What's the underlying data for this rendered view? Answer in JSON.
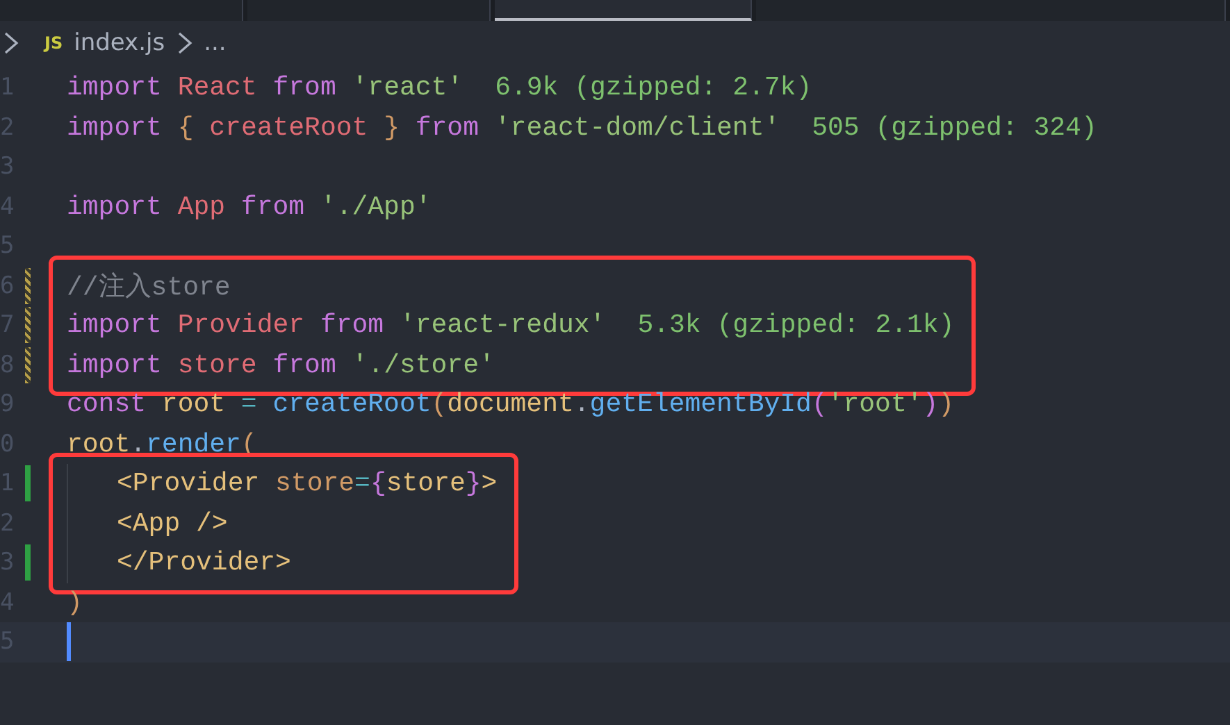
{
  "tabs": [
    {
      "selected": false
    },
    {
      "selected": false
    },
    {
      "selected": true
    },
    {
      "selected": false
    }
  ],
  "breadcrumb": {
    "file_badge": "JS",
    "file": "index.js",
    "more": "..."
  },
  "lines": [
    {
      "kind": "line",
      "number": "1",
      "tokens": [
        {
          "kind": "keyword",
          "text": "import"
        },
        {
          "kind": "variable",
          "text": " React"
        },
        {
          "kind": "keyword",
          "text": " from"
        },
        {
          "kind": "string",
          "text": " 'react'"
        }
      ],
      "hint": "6.9k (gzipped: 2.7k)"
    },
    {
      "kind": "line",
      "number": "2",
      "tokens": [
        {
          "kind": "keyword",
          "text": "import"
        },
        {
          "kind": "bracket",
          "text": " {"
        },
        {
          "kind": "variable",
          "text": " createRoot "
        },
        {
          "kind": "bracket",
          "text": "}"
        },
        {
          "kind": "keyword",
          "text": " from"
        },
        {
          "kind": "string",
          "text": " 'react-dom/client'"
        }
      ],
      "hint": "505 (gzipped: 324)"
    },
    {
      "kind": "line",
      "number": "3"
    },
    {
      "kind": "line",
      "number": "4",
      "tokens": [
        {
          "kind": "keyword",
          "text": "import"
        },
        {
          "kind": "variable",
          "text": " App"
        },
        {
          "kind": "keyword",
          "text": " from"
        },
        {
          "kind": "string",
          "text": " './App'"
        }
      ]
    },
    {
      "kind": "line",
      "number": "5"
    },
    {
      "kind": "highlight",
      "lines": [
        {
          "kind": "line",
          "number": "6",
          "modified": true,
          "tokens": [
            {
              "kind": "comment",
              "text": "//注入store"
            }
          ]
        },
        {
          "kind": "line",
          "number": "7",
          "modified": true,
          "tokens": [
            {
              "kind": "keyword",
              "text": "import"
            },
            {
              "kind": "variable",
              "text": " Provider"
            },
            {
              "kind": "keyword",
              "text": " from"
            },
            {
              "kind": "string",
              "text": " 'react-redux'"
            }
          ],
          "hint": "5.3k (gzipped: 2.1k)"
        },
        {
          "kind": "line",
          "number": "8",
          "modified": true,
          "tokens": [
            {
              "kind": "keyword",
              "text": "import"
            },
            {
              "kind": "variable",
              "text": " store"
            },
            {
              "kind": "keyword",
              "text": " from"
            },
            {
              "kind": "string",
              "text": " './store'"
            }
          ]
        }
      ]
    },
    {
      "kind": "line",
      "number": "9",
      "tokens": [
        {
          "kind": "keyword",
          "text": "const"
        },
        {
          "kind": "param",
          "text": " root"
        },
        {
          "kind": "operator",
          "text": " ="
        },
        {
          "kind": "function",
          "text": " createRoot"
        },
        {
          "kind": "bracket",
          "text": "("
        },
        {
          "kind": "param",
          "text": "document"
        },
        {
          "kind": "plain",
          "text": "."
        },
        {
          "kind": "function",
          "text": "getElementById"
        },
        {
          "kind": "bracket2",
          "text": "("
        },
        {
          "kind": "string",
          "text": "'root'"
        },
        {
          "kind": "bracket2",
          "text": ")"
        },
        {
          "kind": "bracket",
          "text": ")"
        }
      ]
    },
    {
      "kind": "line",
      "number": "0",
      "tokens": [
        {
          "kind": "param",
          "text": "root"
        },
        {
          "kind": "plain",
          "text": "."
        },
        {
          "kind": "function",
          "text": "render"
        },
        {
          "kind": "bracket",
          "text": "("
        }
      ],
      "children": [
        {
          "kind": "highlight",
          "lines": [
            {
              "kind": "line",
              "number": "1",
              "added": true,
              "tokens": [
                {
                  "kind": "tag",
                  "text": "<Provider"
                },
                {
                  "kind": "attr",
                  "text": " store"
                },
                {
                  "kind": "operator",
                  "text": "="
                },
                {
                  "kind": "bracket2",
                  "text": "{"
                },
                {
                  "kind": "tag",
                  "text": "store"
                },
                {
                  "kind": "bracket2",
                  "text": "}"
                },
                {
                  "kind": "tag",
                  "text": ">"
                }
              ]
            },
            {
              "kind": "line",
              "number": "2",
              "tokens": [
                {
                  "kind": "tag",
                  "text": "<App />"
                }
              ]
            },
            {
              "kind": "line",
              "number": "3",
              "added": true,
              "tokens": [
                {
                  "kind": "tag",
                  "text": "</Provider>"
                }
              ]
            }
          ]
        }
      ]
    },
    {
      "kind": "line",
      "number": "4",
      "tokens": [
        {
          "kind": "bracket",
          "text": ")"
        }
      ]
    },
    {
      "kind": "line",
      "number": "5",
      "current": true
    }
  ]
}
